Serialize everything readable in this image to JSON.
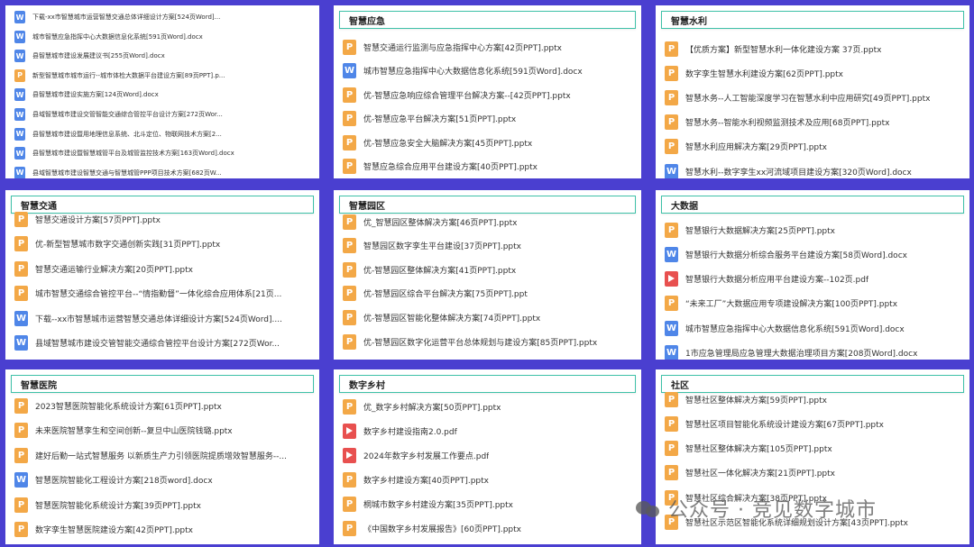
{
  "panels": [
    {
      "id": "top-left",
      "title": "",
      "small": true,
      "files": [
        {
          "type": "doc",
          "name": "下载-xx市智慧城市运营智慧交通总体详细设计方案[524页Word]..."
        },
        {
          "type": "doc",
          "name": "城市智慧应急指挥中心大数据信息化系统[591页Word].docx"
        },
        {
          "type": "doc",
          "name": "县智慧城市建设发展建议书[255页Word].docx"
        },
        {
          "type": "ppt",
          "name": "新型智慧城市城市运行--城市体检大数据平台建设方案[89页PPT].p..."
        },
        {
          "type": "doc",
          "name": "县智慧城市建设实施方案[124页Word].docx"
        },
        {
          "type": "doc",
          "name": "县域智慧城市建设交管智能交通综合管控平台设计方案[272页Wor..."
        },
        {
          "type": "doc",
          "name": "县智慧城市建设暨用地理信息系统、北斗定位、物联网技术方案[2..."
        },
        {
          "type": "doc",
          "name": "县智慧城市建设暨智慧城管平台及城管监控技术方案[163页Word].docx"
        },
        {
          "type": "doc",
          "name": "县域智慧城市建设智慧交通与智慧城管PPP项目技术方案[682页W..."
        }
      ]
    },
    {
      "id": "emergency",
      "title": "智慧应急",
      "files": [
        {
          "type": "ppt",
          "name": "智慧交通运行监测与应急指挥中心方案[42页PPT].pptx"
        },
        {
          "type": "doc",
          "name": "城市智慧应急指挥中心大数据信息化系统[591页Word].docx"
        },
        {
          "type": "ppt",
          "name": "优-智慧应急响应综合管理平台解决方案--[42页PPT].pptx"
        },
        {
          "type": "ppt",
          "name": "优-智慧应急平台解决方案[51页PPT].pptx"
        },
        {
          "type": "ppt",
          "name": "优-智慧应急安全大脑解决方案[45页PPT].pptx"
        },
        {
          "type": "ppt",
          "name": "智慧应急综合应用平台建设方案[40页PPT].pptx"
        }
      ]
    },
    {
      "id": "water",
      "title": "智慧水利",
      "files": [
        {
          "type": "ppt",
          "name": "【优质方案】新型智慧水利一体化建设方案 37页.pptx"
        },
        {
          "type": "ppt",
          "name": "数字孪生智慧水利建设方案[62页PPT].pptx"
        },
        {
          "type": "ppt",
          "name": "智慧水务--人工智能深度学习在智慧水利中应用研究[49页PPT].pptx"
        },
        {
          "type": "ppt",
          "name": "智慧水务--智能水利视频监测技术及应用[68页PPT].pptx"
        },
        {
          "type": "ppt",
          "name": "智慧水利应用解决方案[29页PPT].pptx"
        },
        {
          "type": "doc",
          "name": "智慧水利--数字孪生xx河流域项目建设方案[320页Word].docx"
        }
      ]
    },
    {
      "id": "transport",
      "title": "智慧交通",
      "files": [
        {
          "type": "ppt",
          "name": "智慧交通设计方案[57页PPT].pptx"
        },
        {
          "type": "ppt",
          "name": "优-新型智慧城市数字交通创新实践[31页PPT].pptx"
        },
        {
          "type": "ppt",
          "name": "智慧交通运输行业解决方案[20页PPT].pptx"
        },
        {
          "type": "ppt",
          "name": "城市智慧交通综合管控平台--“情指勤督”一体化综合应用体系[21页..."
        },
        {
          "type": "doc",
          "name": "下载--xx市智慧城市运营智慧交通总体详细设计方案[524页Word]...."
        },
        {
          "type": "doc",
          "name": "县域智慧城市建设交管智能交通综合管控平台设计方案[272页Wor..."
        }
      ]
    },
    {
      "id": "park",
      "title": "智慧园区",
      "files": [
        {
          "type": "ppt",
          "name": "优_智慧园区整体解决方案[46页PPT].pptx"
        },
        {
          "type": "ppt",
          "name": "智慧园区数字孪生平台建设[37页PPT].pptx"
        },
        {
          "type": "ppt",
          "name": "优-智慧园区整体解决方案[41页PPT].pptx"
        },
        {
          "type": "ppt",
          "name": "优-智慧园区综合平台解决方案[75页PPT].ppt"
        },
        {
          "type": "ppt",
          "name": "优-智慧园区智能化整体解决方案[74页PPT].pptx"
        },
        {
          "type": "ppt",
          "name": "优-智慧园区数字化运营平台总体规划与建设方案[85页PPT].pptx"
        }
      ]
    },
    {
      "id": "bigdata",
      "title": "大数据",
      "files": [
        {
          "type": "ppt",
          "name": "智慧银行大数据解决方案[25页PPT].pptx"
        },
        {
          "type": "doc",
          "name": "智慧银行大数据分析综合服务平台建设方案[58页Word].docx"
        },
        {
          "type": "pdf",
          "name": "智慧银行大数据分析应用平台建设方案--102页.pdf"
        },
        {
          "type": "ppt",
          "name": "“未来工厂”大数据应用专项建设解决方案[100页PPT].pptx"
        },
        {
          "type": "doc",
          "name": "城市智慧应急指挥中心大数据信息化系统[591页Word].docx"
        },
        {
          "type": "doc",
          "name": "1市应急管理局应急管理大数据治理项目方案[208页Word].docx"
        }
      ]
    },
    {
      "id": "hospital",
      "title": "智慧医院",
      "files": [
        {
          "type": "ppt",
          "name": "2023智慧医院智能化系统设计方案[61页PPT].pptx"
        },
        {
          "type": "ppt",
          "name": "未来医院智慧孪生和空间创新--复旦中山医院钱璐.pptx"
        },
        {
          "type": "ppt",
          "name": "建好后勤一站式智慧服务 以新质生产力引领医院提质增效智慧服务--..."
        },
        {
          "type": "doc",
          "name": "智慧医院智能化工程设计方案[218页word].docx"
        },
        {
          "type": "ppt",
          "name": "智慧医院智能化系统设计方案[39页PPT].pptx"
        },
        {
          "type": "ppt",
          "name": "数字孪生智慧医院建设方案[42页PPT].pptx"
        }
      ]
    },
    {
      "id": "village",
      "title": "数字乡村",
      "files": [
        {
          "type": "ppt",
          "name": "优_数字乡村解决方案[50页PPT].pptx"
        },
        {
          "type": "pdf",
          "name": "数字乡村建设指南2.0.pdf"
        },
        {
          "type": "pdf",
          "name": "2024年数字乡村发展工作要点.pdf"
        },
        {
          "type": "ppt",
          "name": "数字乡村建设方案[40页PPT].pptx"
        },
        {
          "type": "ppt",
          "name": "桐城市数字乡村建设方案[35页PPT].pptx"
        },
        {
          "type": "ppt",
          "name": "《中国数字乡村发展报告》[60页PPT].pptx"
        }
      ]
    },
    {
      "id": "community",
      "title": "社区",
      "files": [
        {
          "type": "ppt",
          "name": "智慧社区整体解决方案[59页PPT].pptx"
        },
        {
          "type": "ppt",
          "name": "智慧社区项目智能化系统设计建设方案[67页PPT].pptx"
        },
        {
          "type": "ppt",
          "name": "智慧社区整体解决方案[105页PPT].pptx"
        },
        {
          "type": "ppt",
          "name": "智慧社区一体化解决方案[21页PPT].pptx"
        },
        {
          "type": "ppt",
          "name": "智慧社区综合解决方案[38页PPT].pptx"
        },
        {
          "type": "ppt",
          "name": "智慧社区示范区智能化系统详细规划设计方案[43页PPT].pptx"
        }
      ]
    }
  ],
  "icons": {
    "ppt": "P",
    "doc": "W",
    "pdf": ""
  },
  "watermark": "公众号 · 竞见数字城市",
  "colors": {
    "background": "#4a3fd0",
    "header_border": "#3ec1a8",
    "ppt": "#f3a847",
    "doc": "#4f86e8",
    "pdf": "#e8504f"
  }
}
